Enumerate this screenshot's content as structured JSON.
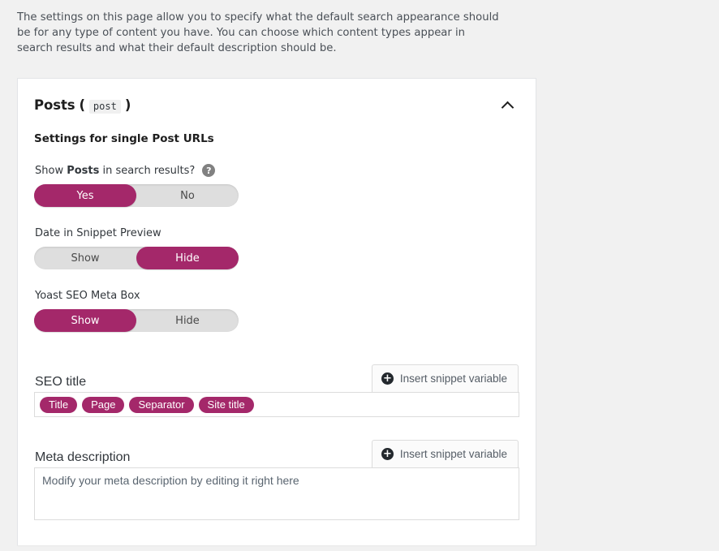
{
  "intro": {
    "text": "The settings on this page allow you to specify what the default search appearance should be for any type of content you have. You can choose which content types appear in search results and what their default description should be."
  },
  "card": {
    "title": "Posts",
    "paren_open": "(",
    "code_name": "post",
    "paren_close": ")",
    "collapse_icon": "chevron-up-icon",
    "subtitle": "Settings for single Post URLs",
    "show_in_search": {
      "label_prefix": "Show",
      "label_strong": "Posts",
      "label_suffix": "in search results?",
      "help_icon": "help-icon",
      "help_glyph": "?",
      "options": [
        "Yes",
        "No"
      ],
      "selected": "Yes"
    },
    "date_snippet": {
      "label": "Date in Snippet Preview",
      "options": [
        "Show",
        "Hide"
      ],
      "selected": "Hide"
    },
    "meta_box": {
      "label": "Yoast SEO Meta Box",
      "options": [
        "Show",
        "Hide"
      ],
      "selected": "Show"
    },
    "seo_title": {
      "label": "SEO title",
      "insert_button": "Insert snippet variable",
      "insert_icon": "plus-circle-icon",
      "tokens": [
        "Title",
        "Page",
        "Separator",
        "Site title"
      ]
    },
    "meta_description": {
      "label": "Meta description",
      "insert_button": "Insert snippet variable",
      "insert_icon": "plus-circle-icon",
      "placeholder": "Modify your meta description by editing it right here"
    }
  },
  "colors": {
    "accent": "#a4286a",
    "page_bg": "#f1f1f1",
    "card_bg": "#ffffff",
    "track": "#dedede"
  }
}
